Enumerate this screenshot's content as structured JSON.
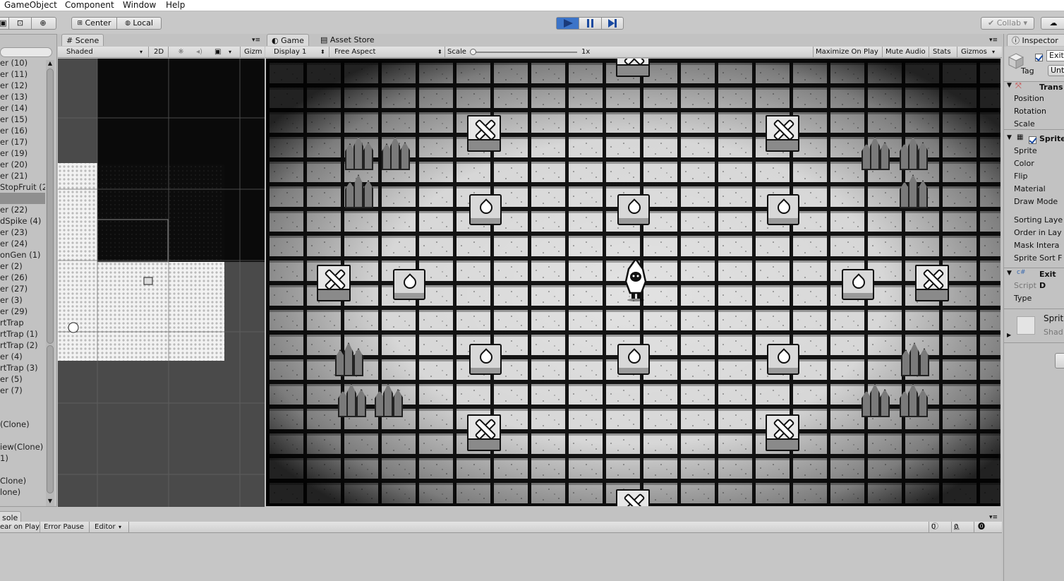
{
  "menu": [
    "GameObject",
    "Component",
    "Window",
    "Help"
  ],
  "toolbar": {
    "pivot_center": "Center",
    "pivot_local": "Local",
    "collab": "Collab",
    "play_icon": "play-icon",
    "pause_icon": "pause-icon",
    "step_icon": "step-icon"
  },
  "scene": {
    "tab": "Scene",
    "shading": "Shaded",
    "mode_2d": "2D",
    "gizmos": "Gizm"
  },
  "game": {
    "tab": "Game",
    "asset_store_tab": "Asset Store",
    "display": "Display 1",
    "aspect": "Free Aspect",
    "scale_label": "Scale",
    "scale_value": "1x",
    "maximize": "Maximize On Play",
    "mute": "Mute Audio",
    "stats": "Stats",
    "gizmos": "Gizmos"
  },
  "hierarchy": {
    "items": [
      "er (10)",
      "er (11)",
      "er (12)",
      "er (13)",
      "er (14)",
      "er (15)",
      "er (16)",
      "er (17)",
      "er (19)",
      "er (20)",
      "er (21)",
      "StopFruit (2",
      "",
      "er (22)",
      "dSpike (4)",
      "er (23)",
      "er (24)",
      "onGen (1)",
      "er (2)",
      "er (26)",
      "er (27)",
      "er (3)",
      "er (29)",
      "rtTrap",
      "rtTrap (1)",
      "rtTrap (2)",
      "er (4)",
      "rtTrap (3)",
      "er (5)",
      "er (7)",
      "",
      "(Clone)",
      "",
      "iew(Clone)",
      "1)",
      "",
      "Clone)",
      "lone)"
    ]
  },
  "inspector": {
    "tab": "Inspector",
    "object_name": "Exit",
    "tag_label": "Tag",
    "tag_value": "Unt",
    "transform": {
      "header": "Trans",
      "fields": [
        "Position",
        "Rotation",
        "Scale"
      ]
    },
    "sprite_renderer": {
      "header": "Sprite",
      "fields": [
        "Sprite",
        "Color",
        "Flip",
        "Material",
        "Draw Mode",
        "",
        "Sorting Laye",
        "Order in Lay",
        "Mask Intera",
        "Sprite Sort F"
      ]
    },
    "script_component": {
      "header": "Exit D",
      "fields": [
        "Script",
        "Type"
      ]
    },
    "material": {
      "name": "Sprit",
      "shader": "Shad"
    }
  },
  "console": {
    "tab": "sole",
    "clear_on_play": "ear on Play",
    "error_pause": "Error Pause",
    "editor": "Editor",
    "info_count": "0",
    "warn_count": "0",
    "error_count": "0"
  }
}
